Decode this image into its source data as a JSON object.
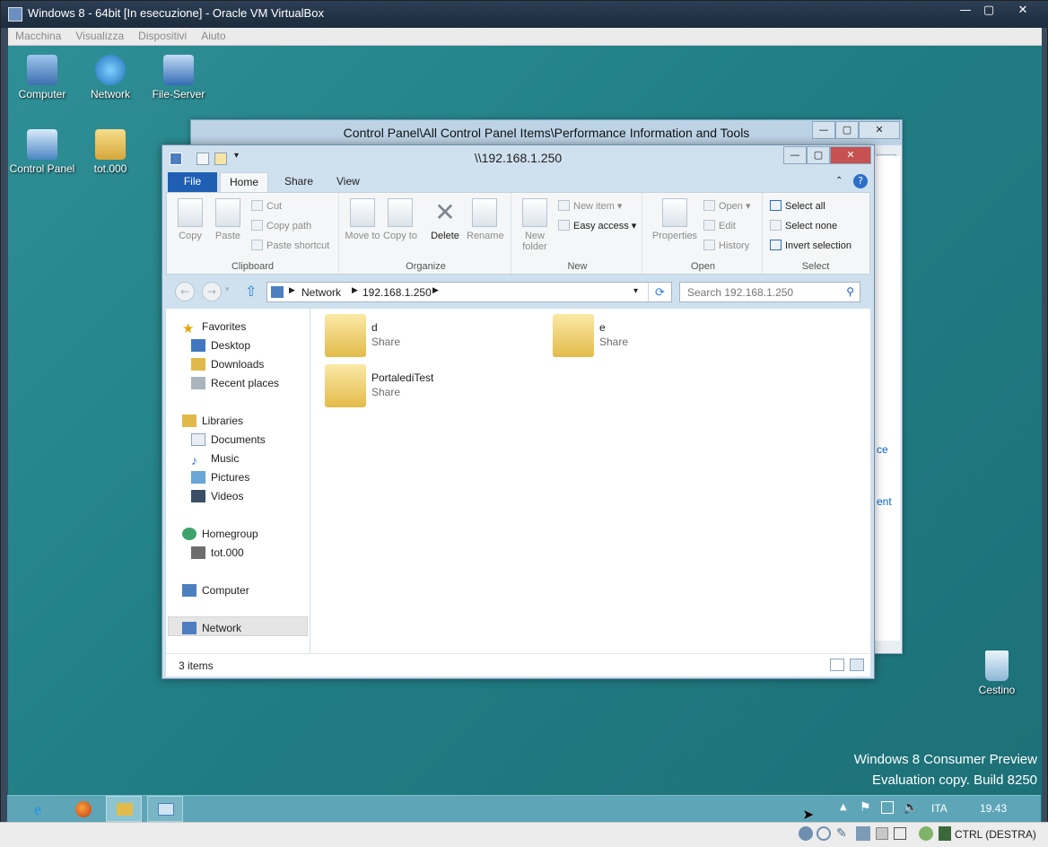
{
  "host": {
    "title": "Windows 8 - 64bit [In esecuzione] - Oracle VM VirtualBox",
    "menu": [
      "Macchina",
      "Visualizza",
      "Dispositivi",
      "Aiuto"
    ],
    "buttons": {
      "minimize": "—",
      "maximize": "▢",
      "close": "✕"
    }
  },
  "desktop": {
    "icons": [
      {
        "label": "Computer",
        "icon": "computer-icon",
        "color": "#4a7fc1"
      },
      {
        "label": "Network",
        "icon": "network-globe-icon",
        "color": "#2f8fd6"
      },
      {
        "label": "File-Server",
        "icon": "file-server-icon",
        "color": "#3a78c8"
      },
      {
        "label": "Control Panel",
        "icon": "control-panel-icon",
        "color": "#4b86c4"
      },
      {
        "label": "tot.000",
        "icon": "user-folder-icon",
        "color": "#e0b94a"
      },
      {
        "label": "Cestino",
        "icon": "recycle-bin-icon",
        "color": "#b8d4ea"
      }
    ],
    "watermark": {
      "line1": "Windows 8 Consumer Preview",
      "line2": "Evaluation copy. Build 8250"
    }
  },
  "control_panel_window": {
    "title": "Control Panel\\All Control Panel Items\\Performance Information and Tools",
    "peek1": "ce",
    "peek2": "ent"
  },
  "explorer": {
    "title": "\\\\192.168.1.250",
    "tabs": {
      "file": "File",
      "home": "Home",
      "share": "Share",
      "view": "View"
    },
    "ribbon": {
      "clipboard": {
        "label": "Clipboard",
        "copy": "Copy",
        "paste": "Paste",
        "cut": "Cut",
        "copy_path": "Copy path",
        "paste_shortcut": "Paste shortcut"
      },
      "organize": {
        "label": "Organize",
        "move_to": "Move to",
        "copy_to": "Copy to",
        "delete": "Delete",
        "rename": "Rename"
      },
      "new": {
        "label": "New",
        "new_folder": "New folder",
        "new_item": "New item",
        "easy_access": "Easy access"
      },
      "open": {
        "label": "Open",
        "properties": "Properties",
        "open": "Open",
        "edit": "Edit",
        "history": "History"
      },
      "select": {
        "label": "Select",
        "select_all": "Select all",
        "select_none": "Select none",
        "invert": "Invert selection"
      }
    },
    "address": {
      "crumbs": [
        "Network",
        "192.168.1.250"
      ]
    },
    "search": {
      "placeholder": "Search 192.168.1.250"
    },
    "nav": {
      "favorites": "Favorites",
      "desktop": "Desktop",
      "downloads": "Downloads",
      "recent": "Recent places",
      "libraries": "Libraries",
      "documents": "Documents",
      "music": "Music",
      "pictures": "Pictures",
      "videos": "Videos",
      "homegroup": "Homegroup",
      "tot": "tot.000",
      "computer": "Computer",
      "network": "Network"
    },
    "items": [
      {
        "name": "d",
        "type": "Share"
      },
      {
        "name": "e",
        "type": "Share"
      },
      {
        "name": "PortalediTest",
        "type": "Share"
      }
    ],
    "status": "3 items"
  },
  "taskbar": {
    "language": "ITA",
    "time": "19.43"
  },
  "vbox_status": {
    "host_key": "CTRL (DESTRA)"
  }
}
